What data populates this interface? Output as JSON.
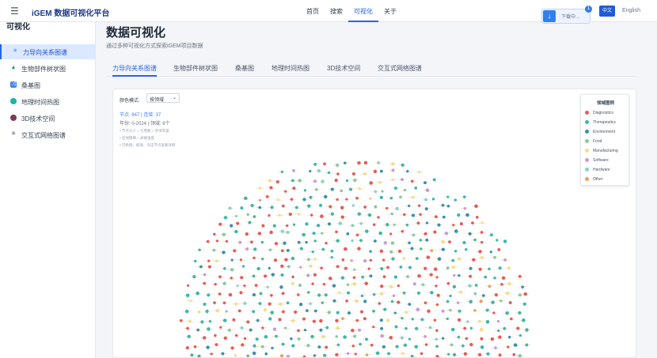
{
  "header": {
    "brand": "iGEM 数据可视化平台",
    "nav": [
      "首页",
      "搜索",
      "可视化",
      "关于"
    ],
    "active_nav": 2,
    "download_label": "下载中...",
    "download_badge": "1",
    "lang_zh": "中文",
    "lang_en": "English"
  },
  "sidebar": {
    "title": "可视化",
    "items": [
      {
        "label": "力导向关系图谱",
        "icon": "atom-icon"
      },
      {
        "label": "生物部件树状图",
        "icon": "tree-icon"
      },
      {
        "label": "桑基图",
        "icon": "sankey-icon"
      },
      {
        "label": "地理时间热图",
        "icon": "globe-icon"
      },
      {
        "label": "3D技术空间",
        "icon": "sphere-icon"
      },
      {
        "label": "交互式网络图谱",
        "icon": "network-icon"
      }
    ]
  },
  "main": {
    "title": "数据可视化",
    "subtitle": "通过多种可视化方式探索iGEM项目数据",
    "tabs": [
      "力导向关系图谱",
      "生物部件树状图",
      "桑基图",
      "地理时间热图",
      "3D技术空间",
      "交互式网络图谱"
    ]
  },
  "graph": {
    "color_mode_label": "颜色模式:",
    "color_mode_value": "按领域",
    "stats_line": "节点: 647 | 连接: 37",
    "years_line": "年份: 0-2024 | 领域: 8个",
    "tips": [
      "• 节点大小 = 引用数 + 奖项荣誉",
      "• 连线粗细 = 关联强度",
      "• 可拖拽、缩放、点击节点查看详情"
    ],
    "legend_title": "领域图例",
    "legend": [
      {
        "label": "Diagnostics",
        "color": "#e45b5b"
      },
      {
        "label": "Therapeutics",
        "color": "#3fb6a8"
      },
      {
        "label": "Environment",
        "color": "#3a8fb0"
      },
      {
        "label": "Food",
        "color": "#8cc7a0"
      },
      {
        "label": "Manufacturing",
        "color": "#f3dc8c"
      },
      {
        "label": "Software",
        "color": "#c99ad6"
      },
      {
        "label": "Hardware",
        "color": "#8fd0c8"
      },
      {
        "label": "Other",
        "color": "#e8a060"
      }
    ]
  }
}
